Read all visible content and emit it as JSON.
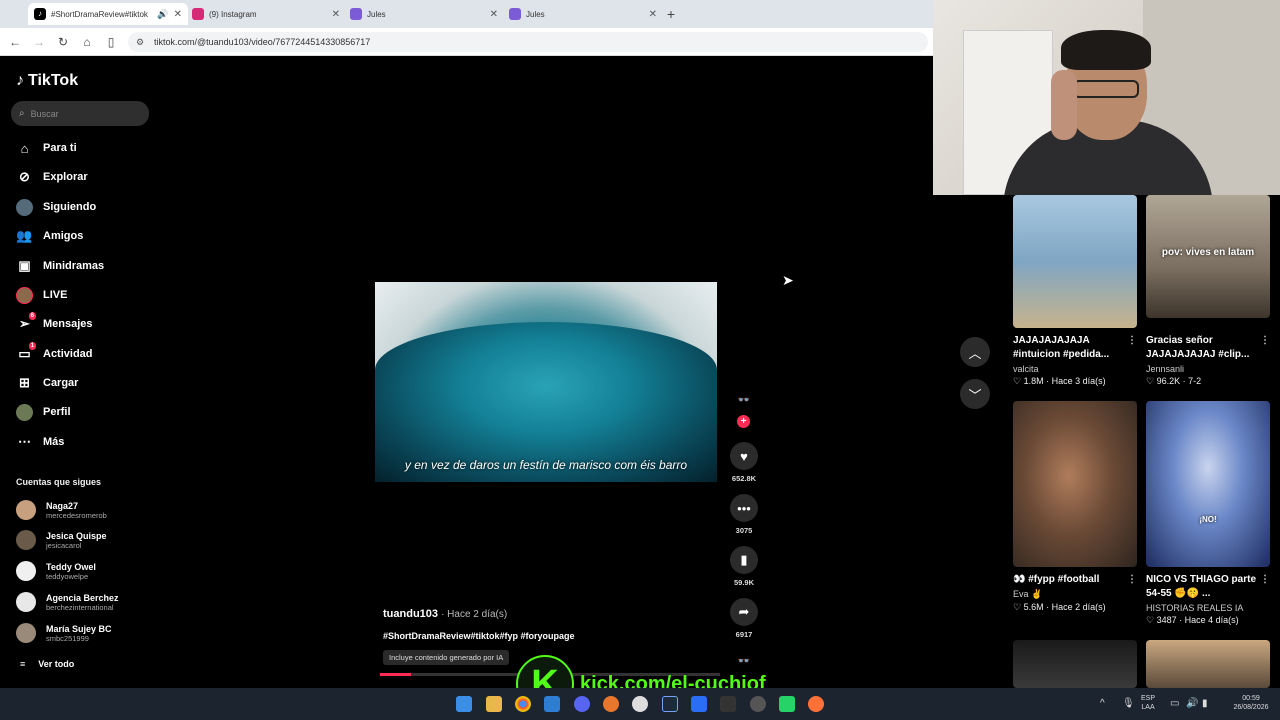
{
  "browser": {
    "tabs": [
      {
        "title": "#ShortDramaReview#tiktok",
        "active": true,
        "favicon_color": "#000000",
        "sound": true
      },
      {
        "title": "(9) Instagram",
        "active": false,
        "favicon_color": "#d62976"
      },
      {
        "title": "Jules",
        "active": false,
        "favicon_color": "#7b5cd6"
      },
      {
        "title": "Jules",
        "active": false,
        "favicon_color": "#7b5cd6"
      }
    ],
    "url": "tiktok.com/@tuandu103/video/7677244514330856717",
    "icons": {
      "back": "back-icon",
      "forward": "forward-icon",
      "reload": "reload-icon",
      "home": "home-icon",
      "sidebar": "sidebar-icon"
    }
  },
  "sidebar": {
    "brand": "TikTok",
    "search_placeholder": "Buscar",
    "nav": [
      {
        "label": "Para ti",
        "icon": "home-icon"
      },
      {
        "label": "Explorar",
        "icon": "compass-icon"
      },
      {
        "label": "Siguiendo",
        "icon": "following-avatar-icon"
      },
      {
        "label": "Amigos",
        "icon": "friends-icon"
      },
      {
        "label": "Minidramas",
        "icon": "film-icon"
      },
      {
        "label": "LIVE",
        "icon": "live-avatar-icon"
      },
      {
        "label": "Mensajes",
        "icon": "message-icon",
        "badge": "6"
      },
      {
        "label": "Actividad",
        "icon": "activity-icon",
        "badge": "1"
      },
      {
        "label": "Cargar",
        "icon": "upload-icon"
      },
      {
        "label": "Perfil",
        "icon": "profile-avatar-icon"
      },
      {
        "label": "Más",
        "icon": "more-icon"
      }
    ],
    "following_header": "Cuentas que sigues",
    "following": [
      {
        "name": "Naga27",
        "handle": "mercedesromerob"
      },
      {
        "name": "Jesica Quispe",
        "handle": "jesicacarol"
      },
      {
        "name": "Teddy Owel",
        "handle": "teddyowelpe"
      },
      {
        "name": "Agencia Berchez",
        "handle": "berchezinternational"
      },
      {
        "name": "María Sujey BC",
        "handle": "smbc251999"
      }
    ],
    "see_all": "Ver todo"
  },
  "video": {
    "caption": "y en vez de daros un festín de marisco com éis barro",
    "author": "tuandu103",
    "date": "· Hace 2 día(s)",
    "hashtags": "#ShortDramaReview#tiktok#fyp #foryoupage",
    "ai_label": "Incluye contenido generado por IA",
    "progress": 0.09,
    "actions": [
      {
        "name": "like",
        "icon": "heart-icon",
        "count": "652.8K"
      },
      {
        "name": "comment",
        "icon": "comment-icon",
        "count": "3075"
      },
      {
        "name": "save",
        "icon": "bookmark-icon",
        "count": "59.9K"
      },
      {
        "name": "share",
        "icon": "share-icon",
        "count": "6917"
      }
    ]
  },
  "feed": [
    {
      "title": "JAJAJAJAJAJA #intuicion #pedida...",
      "author": "valcita",
      "likes": "1.8M",
      "date": "Hace 3 día(s)",
      "overlay": "",
      "colors": [
        "#8fb8d8",
        "#c9b58a"
      ]
    },
    {
      "title": "Gracias señor JAJAJAJAJAJ #clip...",
      "author": "Jennsanli",
      "likes": "96.2K",
      "date": "7-2",
      "overlay": "pov: vives en latam",
      "colors": [
        "#9b8f80",
        "#4a4036"
      ]
    },
    {
      "title": "👀 #fypp #football",
      "author": "Eva ✌",
      "likes": "5.6M",
      "date": "Hace 2 día(s)",
      "overlay": "",
      "colors": [
        "#5a4a3e",
        "#2a2520"
      ]
    },
    {
      "title": "NICO VS THIAGO parte 54-55 ✊🤫 ...",
      "author": "HISTORIAS REALES IA",
      "likes": "3487",
      "date": "Hace 4 día(s)",
      "overlay": "¡NO!",
      "colors": [
        "#5a7ec6",
        "#1a2a5a"
      ]
    }
  ],
  "overlay": {
    "kick_letter": "K",
    "kick_text": "kick.com/el-cuchiof"
  },
  "taskbar": {
    "lang": "ESP",
    "region": "LAA",
    "time": "00:59",
    "date": "26/08/2026"
  }
}
